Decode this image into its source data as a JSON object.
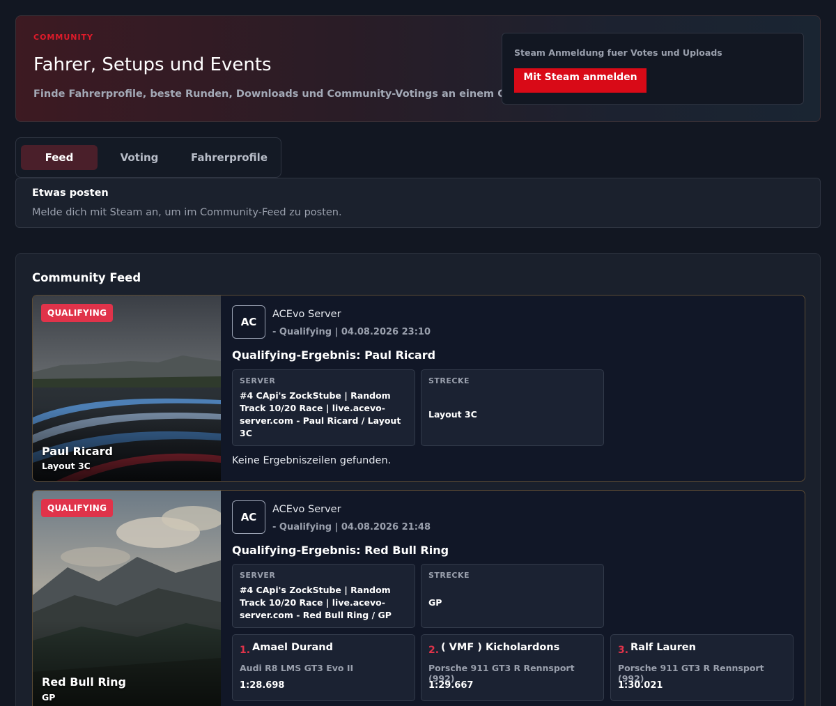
{
  "hero": {
    "eyebrow": "COMMUNITY",
    "title": "Fahrer, Setups und Events",
    "subtitle": "Finde Fahrerprofile, beste Runden, Downloads und Community-Votings an einem Ort.",
    "login_hint": "Steam Anmeldung fuer Votes und Uploads",
    "login_button": "Mit Steam anmelden"
  },
  "tabs": [
    {
      "label": "Feed",
      "active": true
    },
    {
      "label": "Voting",
      "active": false
    },
    {
      "label": "Fahrerprofile",
      "active": false
    }
  ],
  "post": {
    "title": "Etwas posten",
    "text": "Melde dich mit Steam an, um im Community-Feed zu posten."
  },
  "feed": {
    "title": "Community Feed",
    "cards": [
      {
        "badge": "QUALIFYING",
        "track_name": "Paul Ricard",
        "track_layout": "Layout 3C",
        "avatar": "AC",
        "author": "ACEvo Server",
        "meta": "- Qualifying | 04.08.2026 23:10",
        "title": "Qualifying-Ergebnis: Paul Ricard",
        "server_label": "SERVER",
        "server_value": "#4 CApi's ZockStube | Random Track 10/20 Race | live.acevo-server.com - Paul Ricard / Layout 3C",
        "track_label": "STRECKE",
        "track_value": "Layout 3C",
        "no_results": "Keine Ergebniszeilen gefunden."
      },
      {
        "badge": "QUALIFYING",
        "track_name": "Red Bull Ring",
        "track_layout": "GP",
        "avatar": "AC",
        "author": "ACEvo Server",
        "meta": "- Qualifying | 04.08.2026 21:48",
        "title": "Qualifying-Ergebnis: Red Bull Ring",
        "server_label": "SERVER",
        "server_value": "#4 CApi's ZockStube | Random Track 10/20 Race | live.acevo-server.com - Red Bull Ring / GP",
        "track_label": "STRECKE",
        "track_value": "GP",
        "results": [
          {
            "rank": "1.",
            "name": "Amael Durand",
            "car": "Audi R8 LMS GT3 Evo II",
            "time": "1:28.698"
          },
          {
            "rank": "2.",
            "name": "( VMF ) Kicholardons",
            "car": "Porsche 911 GT3 R Rennsport (992)",
            "time": "1:29.667"
          },
          {
            "rank": "3.",
            "name": "Ralf Lauren",
            "car": "Porsche 911 GT3 R Rennsport (992)",
            "time": "1:30.021"
          }
        ]
      }
    ]
  }
}
